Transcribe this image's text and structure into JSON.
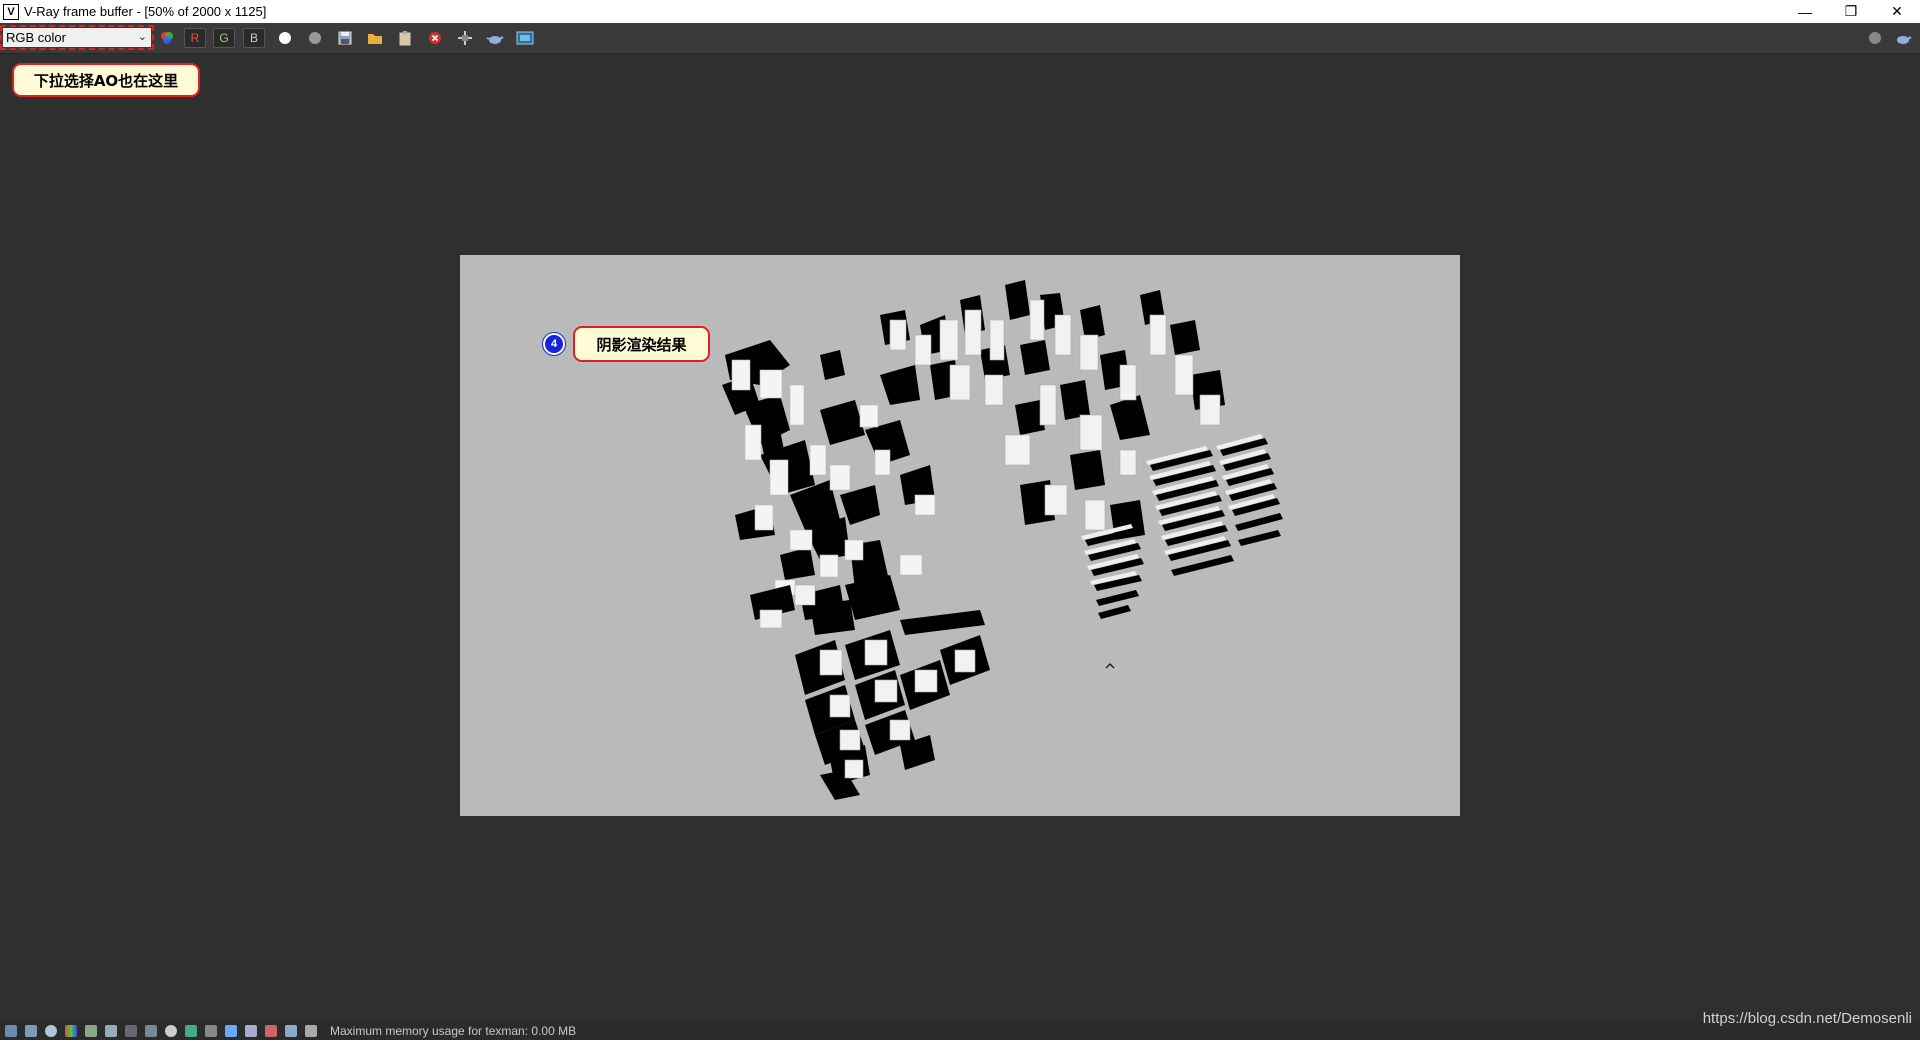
{
  "window": {
    "title": "V-Ray frame buffer - [50% of 2000 x 1125]",
    "icon": "vray-logo-icon",
    "controls": {
      "minimize": "—",
      "restore": "❐",
      "close": "✕"
    }
  },
  "toolbar": {
    "channel_select": {
      "value": "RGB color",
      "chevron": "⌄"
    },
    "buttons": {
      "red": "R",
      "green": "G",
      "blue": "B"
    }
  },
  "annotations": {
    "dropdown_note": "下拉选择AO也在这里",
    "step_number": "4",
    "result_note": "阴影渲染结果"
  },
  "status": {
    "text": "Maximum memory usage for texman: 0.00 MB"
  },
  "watermark": "https://blog.csdn.net/Demosenli"
}
